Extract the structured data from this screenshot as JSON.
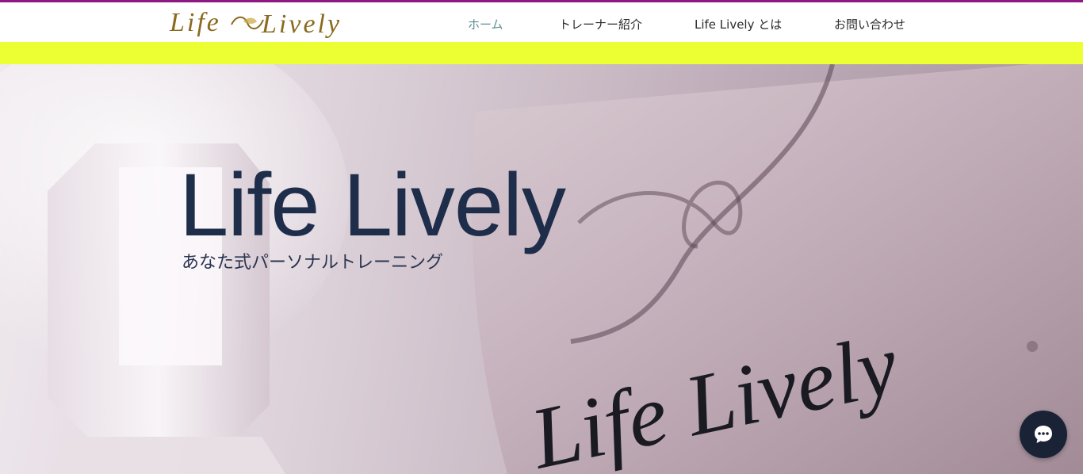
{
  "header": {
    "logo_text": "Life Lively",
    "logo_icon": "infinity-leaf-logo"
  },
  "nav": {
    "items": [
      {
        "label": "ホーム",
        "active": true
      },
      {
        "label": "トレーナー紹介",
        "active": false
      },
      {
        "label": "Life Lively とは",
        "active": false
      },
      {
        "label": "お問い合わせ",
        "active": false
      }
    ]
  },
  "hero": {
    "title": "Life Lively",
    "subtitle": "あなた式パーソナルトレーニング",
    "sign_text": "Life Lively"
  },
  "chat": {
    "icon": "chat-bubble-icon"
  },
  "colors": {
    "top_accent": "#8c1a82",
    "banner": "#ebff33",
    "nav_active": "#5d8f96",
    "title": "#1e2e4a",
    "chat_button": "#1a2236"
  }
}
